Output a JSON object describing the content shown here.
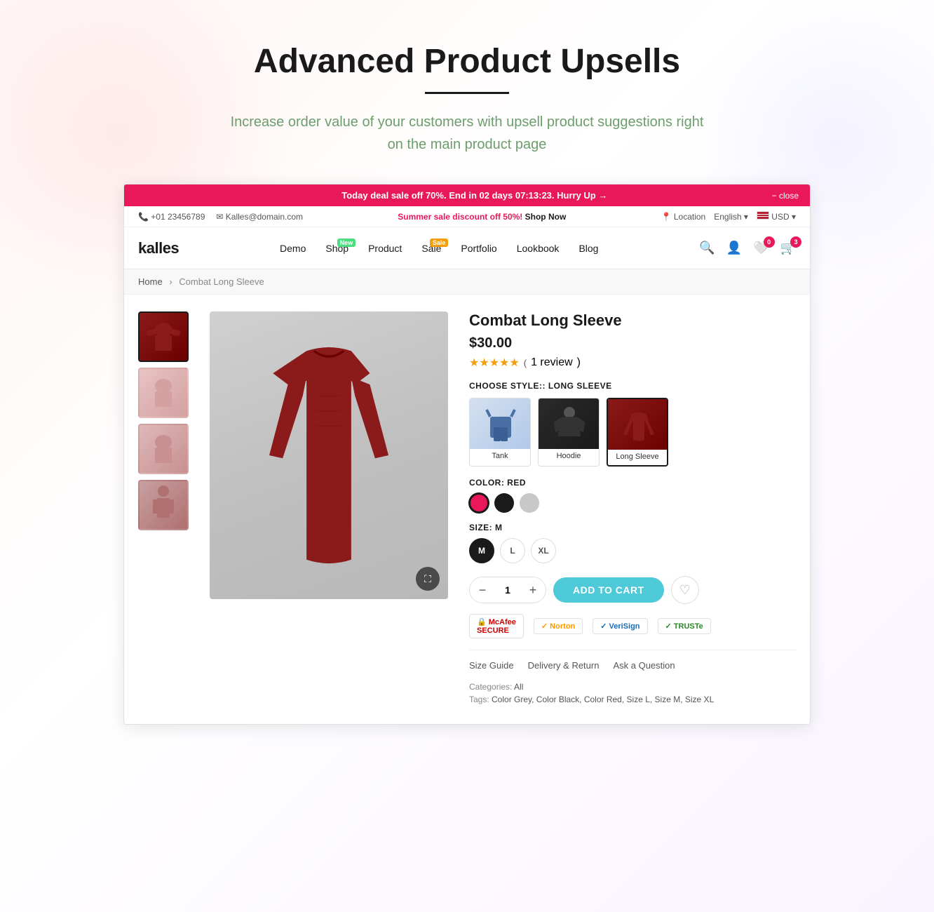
{
  "hero": {
    "title": "Advanced Product Upsells",
    "subtitle": "Increase order value of your customers with upsell product suggestions right on the main product page",
    "divider": true
  },
  "announcement": {
    "text_prefix": "Today deal sale off ",
    "discount": "70%",
    "text_mid": ". End in ",
    "countdown": "02 days 07:13:23",
    "text_suffix": ". Hurry Up →",
    "close_label": "− close"
  },
  "topbar": {
    "phone": "+01 23456789",
    "email": "Kalles@domain.com",
    "promo_text_prefix": "Summer sale discount off ",
    "promo_discount": "50%!",
    "shop_now": "Shop Now",
    "location": "Location",
    "language": "English",
    "currency": "USD"
  },
  "nav": {
    "logo": "kalles",
    "links": [
      {
        "label": "Demo",
        "badge": null
      },
      {
        "label": "Shop",
        "badge": "New"
      },
      {
        "label": "Product",
        "badge": null
      },
      {
        "label": "Sale",
        "badge": "Sale"
      },
      {
        "label": "Portfolio",
        "badge": null
      },
      {
        "label": "Lookbook",
        "badge": null
      },
      {
        "label": "Blog",
        "badge": null
      }
    ],
    "wishlist_count": "0",
    "cart_count": "3"
  },
  "breadcrumb": {
    "home": "Home",
    "current": "Combat Long Sleeve"
  },
  "product": {
    "name": "Combat Long Sleeve",
    "price": "$30.00",
    "reviews": {
      "count": "1 review",
      "stars": 5
    },
    "style_label": "CHOOSE STYLE:: LONG SLEEVE",
    "styles": [
      {
        "label": "Tank",
        "selected": false
      },
      {
        "label": "Hoodie",
        "selected": false
      },
      {
        "label": "Long Sleeve",
        "selected": true
      }
    ],
    "color_label": "COLOR: RED",
    "colors": [
      {
        "name": "Red",
        "class": "color-red",
        "selected": true
      },
      {
        "name": "Black",
        "class": "color-black",
        "selected": false
      },
      {
        "name": "Gray",
        "class": "color-gray",
        "selected": false
      }
    ],
    "size_label": "SIZE: M",
    "sizes": [
      {
        "label": "M",
        "selected": true
      },
      {
        "label": "L",
        "selected": false
      },
      {
        "label": "XL",
        "selected": false
      }
    ],
    "quantity": 1,
    "add_to_cart": "ADD TO CART",
    "trust_badges": [
      {
        "label": "McAfee SECURE",
        "class": "badge-mcafee",
        "icon": "🔒"
      },
      {
        "label": "Norton",
        "class": "badge-norton",
        "icon": "✓"
      },
      {
        "label": "VeriSign",
        "class": "badge-verisign",
        "icon": "✓"
      },
      {
        "label": "TRUSTe",
        "class": "badge-truste",
        "icon": "✓"
      }
    ],
    "info_tabs": [
      "Size Guide",
      "Delivery & Return",
      "Ask a Question"
    ],
    "categories": "All",
    "tags": "Color Grey, Color Black, Color Red, Size L, Size M, Size XL"
  }
}
